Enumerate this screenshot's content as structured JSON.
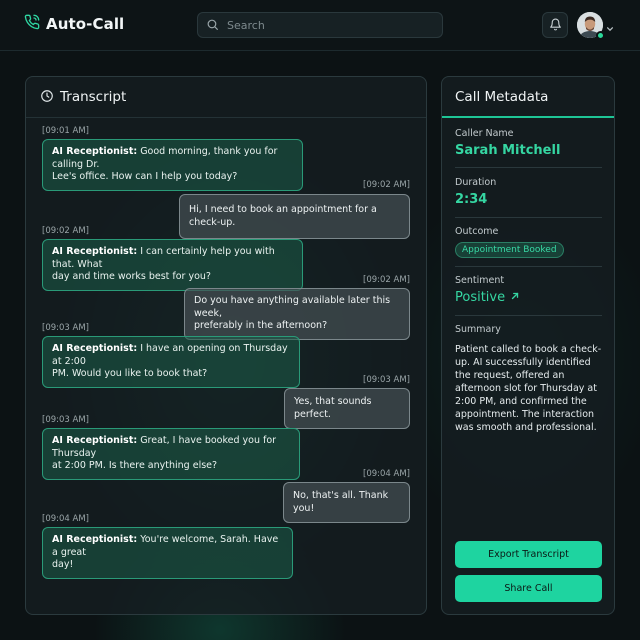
{
  "app": {
    "title": "Auto-Call"
  },
  "search": {
    "placeholder": "Search"
  },
  "icons": {
    "brand": "phone-call-icon",
    "search": "search-icon",
    "notifications": "bell-icon",
    "transcript": "clock-icon",
    "sentiment": "arrow-up-right-icon",
    "menu": "chevron-down-icon"
  },
  "colors": {
    "accent": "#1ed4a0",
    "background": "#0c1214",
    "panel": "#161e21"
  },
  "transcript": {
    "title": "Transcript",
    "messages": [
      {
        "role": "ai",
        "time": "[09:01 AM]",
        "speaker": "AI Receptionist:",
        "line1": " Good morning, thank you for calling Dr.",
        "line2": "Lee's office. How can I help you today?"
      },
      {
        "role": "user",
        "time": "[09:02 AM]",
        "line1": "Hi, I need to book an appointment for a check-up."
      },
      {
        "role": "ai",
        "time": "[09:02 AM]",
        "speaker": "AI Receptionist:",
        "line1": " I can certainly help you with that. What",
        "line2": "day and time works best for you?"
      },
      {
        "role": "user",
        "time": "[09:02 AM]",
        "line1": "Do you have anything available later this week,",
        "line2": "preferably in the afternoon?"
      },
      {
        "role": "ai",
        "time": "[09:03 AM]",
        "speaker": "AI Receptionist:",
        "line1": " I have an opening on Thursday at 2:00",
        "line2": "PM. Would you like to book that?"
      },
      {
        "role": "user",
        "time": "[09:03 AM]",
        "line1": "Yes, that sounds perfect."
      },
      {
        "role": "ai",
        "time": "[09:03 AM]",
        "speaker": "AI Receptionist:",
        "line1": " Great, I have booked you for Thursday",
        "line2": "at 2:00 PM. Is there anything else?"
      },
      {
        "role": "user",
        "time": "[09:04 AM]",
        "line1": "No, that's all. Thank you!"
      },
      {
        "role": "ai",
        "time": "[09:04 AM]",
        "speaker": "AI Receptionist:",
        "line1": " You're welcome, Sarah. Have a great",
        "line2": "day!"
      }
    ]
  },
  "metadata": {
    "title": "Call Metadata",
    "caller_label": "Caller Name",
    "caller_value": "Sarah Mitchell",
    "duration_label": "Duration",
    "duration_value": "2:34",
    "outcome_label": "Outcome",
    "outcome_value": "Appointment Booked",
    "sentiment_label": "Sentiment",
    "sentiment_value": "Positive",
    "summary_label": "Summary",
    "summary_text": "Patient called to book a check-up. AI successfully identified the request, offered an afternoon slot for Thursday at 2:00 PM, and confirmed the appointment. The interaction was smooth and professional."
  },
  "actions": {
    "export_label": "Export Transcript",
    "share_label": "Share Call"
  }
}
